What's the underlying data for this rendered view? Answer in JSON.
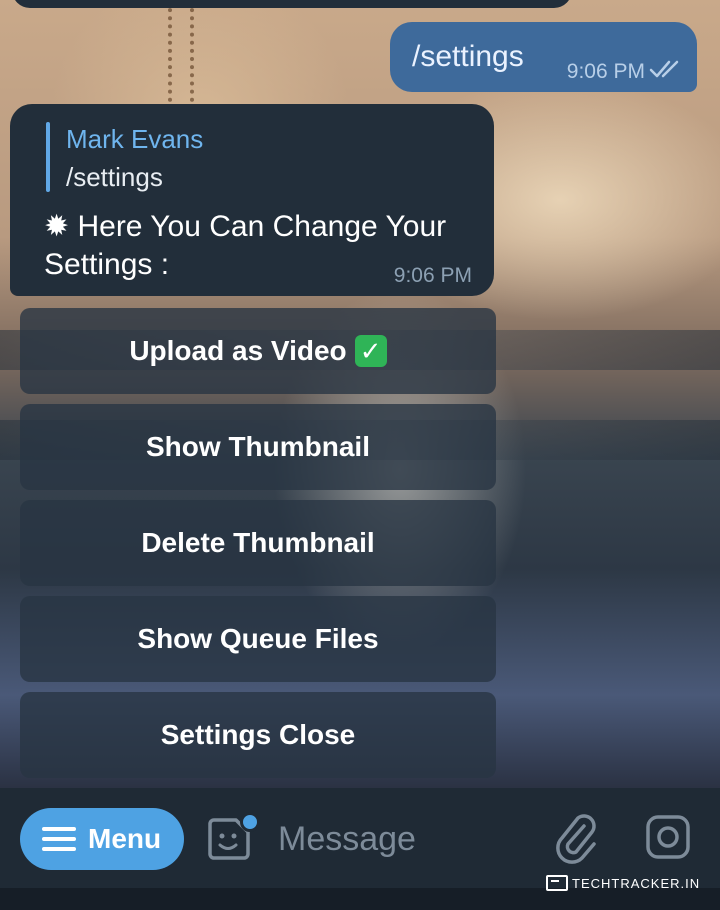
{
  "chat": {
    "outgoing": {
      "text": "/settings",
      "time": "9:06 PM",
      "status_icon": "double-check-icon"
    },
    "incoming": {
      "reply_to_name": "Mark Evans",
      "reply_to_text": "/settings",
      "body": "✹ Here You Can Change Your Settings :",
      "time": "9:06 PM"
    }
  },
  "inline_keyboard": {
    "buttons": [
      {
        "label": "Upload as Video",
        "emoji": "✓"
      },
      {
        "label": "Show Thumbnail"
      },
      {
        "label": "Delete Thumbnail"
      },
      {
        "label": "Show Queue Files"
      },
      {
        "label": "Settings Close"
      }
    ]
  },
  "input_bar": {
    "menu_label": "Menu",
    "placeholder": "Message",
    "icons": [
      "menu-icon",
      "sticker-icon",
      "attach-icon",
      "camera-icon"
    ],
    "accent_color": "#4ea2e3"
  },
  "watermark": {
    "text": "TECHTRACKER.IN"
  }
}
